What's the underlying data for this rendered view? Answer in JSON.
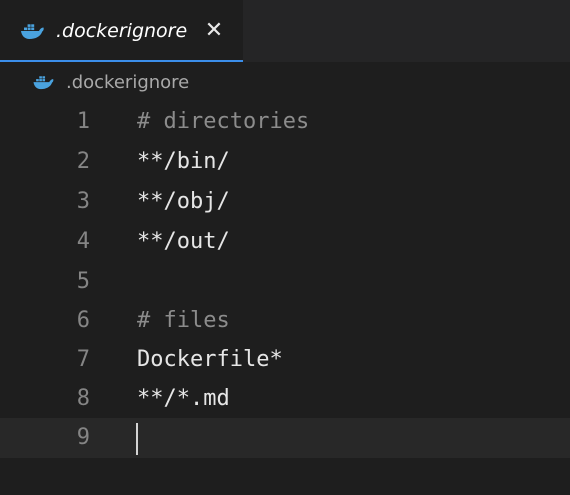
{
  "colors": {
    "accent": "#3b8eea",
    "docker_icon": "#4aa3df",
    "background": "#1e1e1e",
    "comment": "#8c8c8c",
    "text": "#e6e6e6",
    "line_number": "#858585"
  },
  "tab": {
    "icon": "docker-icon",
    "label": ".dockerignore",
    "close_icon": "close-icon",
    "close_glyph": "✕"
  },
  "breadcrumb": {
    "icon": "docker-icon",
    "label": ".dockerignore"
  },
  "editor": {
    "current_line": 9,
    "lines": [
      {
        "number": "1",
        "text": "# directories",
        "kind": "comment"
      },
      {
        "number": "2",
        "text": "**/bin/",
        "kind": "text"
      },
      {
        "number": "3",
        "text": "**/obj/",
        "kind": "text"
      },
      {
        "number": "4",
        "text": "**/out/",
        "kind": "text"
      },
      {
        "number": "5",
        "text": "",
        "kind": "text"
      },
      {
        "number": "6",
        "text": "# files",
        "kind": "comment"
      },
      {
        "number": "7",
        "text": "Dockerfile*",
        "kind": "text"
      },
      {
        "number": "8",
        "text": "**/*.md",
        "kind": "text"
      },
      {
        "number": "9",
        "text": "",
        "kind": "text"
      }
    ]
  }
}
